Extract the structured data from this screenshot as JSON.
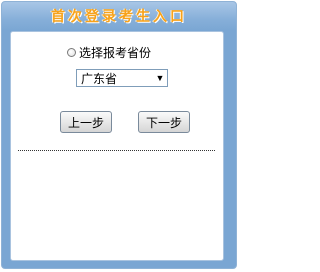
{
  "header": {
    "title": "首次登录考生入口"
  },
  "form": {
    "radio_label": "选择报考省份",
    "province_select": {
      "selected": "广东省",
      "arrow": "▼"
    },
    "prev_button": "上一步",
    "next_button": "下一步"
  },
  "colors": {
    "title": "#f7a21b",
    "frame": "#7aa6d3",
    "content_bg": "#ffffff"
  }
}
